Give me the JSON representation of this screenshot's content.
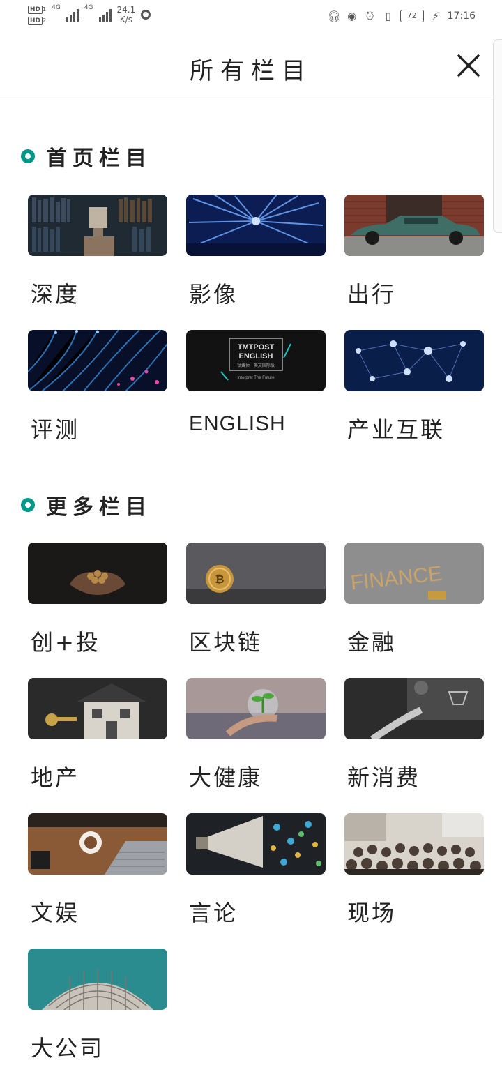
{
  "status_bar": {
    "hd1": "HD",
    "sub1": "1",
    "hd2": "HD",
    "sub2": "2",
    "net1": "4G",
    "net2": "4G",
    "speed_value": "24.1",
    "speed_unit": "K/s",
    "battery": "72",
    "time": "17:16"
  },
  "header": {
    "title": "所有栏目"
  },
  "sections": [
    {
      "title": "首页栏目",
      "items": [
        {
          "label": "深度"
        },
        {
          "label": "影像"
        },
        {
          "label": "出行"
        },
        {
          "label": "评测"
        },
        {
          "label": "ENGLISH",
          "thumb_text_1": "TMTPOST",
          "thumb_text_2": "ENGLISH",
          "thumb_text_3": "钛媒体 · 英文国际版",
          "thumb_text_4": "Interpret The Future"
        },
        {
          "label": "产业互联"
        }
      ]
    },
    {
      "title": "更多栏目",
      "items": [
        {
          "label": "创+投"
        },
        {
          "label": "区块链"
        },
        {
          "label": "金融",
          "thumb_text_1": "FINANCE"
        },
        {
          "label": "地产"
        },
        {
          "label": "大健康"
        },
        {
          "label": "新消费"
        },
        {
          "label": "文娱"
        },
        {
          "label": "言论"
        },
        {
          "label": "现场"
        },
        {
          "label": "大公司"
        }
      ]
    }
  ]
}
